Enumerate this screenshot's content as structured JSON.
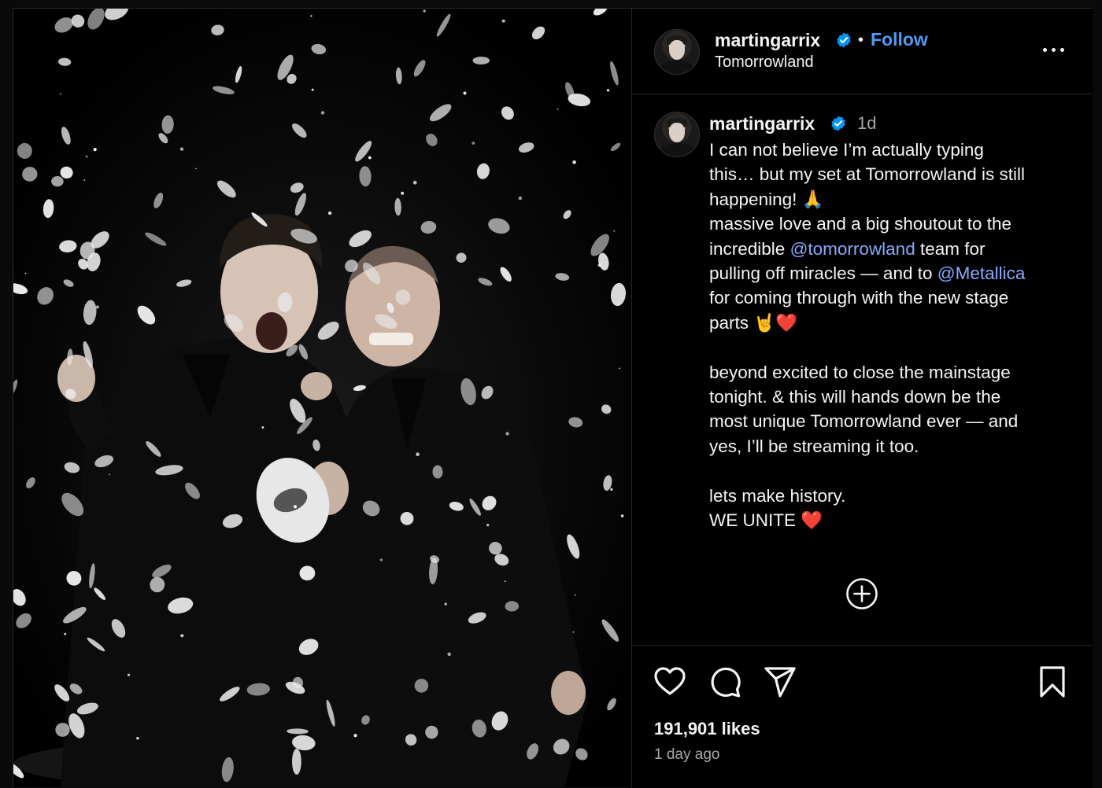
{
  "post": {
    "username": "martingarrix",
    "location": "Tomorrowland",
    "follow_label": "Follow",
    "separator": "•",
    "caption_time": "1d",
    "caption_lines": [
      {
        "parts": [
          {
            "t": "I can not believe I’m actually typing"
          }
        ]
      },
      {
        "parts": [
          {
            "t": "this… but my set at Tomorrowland is still"
          }
        ]
      },
      {
        "parts": [
          {
            "t": "happening! 🙏"
          }
        ]
      },
      {
        "parts": [
          {
            "t": "massive love and a big shoutout to the"
          }
        ]
      },
      {
        "parts": [
          {
            "t": "incredible "
          },
          {
            "t": "@tomorrowland",
            "mention": true
          },
          {
            "t": " team for"
          }
        ]
      },
      {
        "parts": [
          {
            "t": "pulling off miracles — and to "
          },
          {
            "t": "@Metallica",
            "mention": true
          }
        ]
      },
      {
        "parts": [
          {
            "t": "for coming through with the new stage"
          }
        ]
      },
      {
        "parts": [
          {
            "t": "parts 🤘❤️"
          }
        ]
      },
      {
        "parts": [
          {
            "t": ""
          }
        ]
      },
      {
        "parts": [
          {
            "t": "beyond excited to close the mainstage"
          }
        ]
      },
      {
        "parts": [
          {
            "t": "tonight. & this will hands down be the"
          }
        ]
      },
      {
        "parts": [
          {
            "t": "most unique Tomorrowland ever — and"
          }
        ]
      },
      {
        "parts": [
          {
            "t": "yes, I’ll be streaming it too."
          }
        ]
      },
      {
        "parts": [
          {
            "t": ""
          }
        ]
      },
      {
        "parts": [
          {
            "t": "lets make history."
          }
        ]
      },
      {
        "parts": [
          {
            "t": "WE UNITE ❤️"
          }
        ]
      }
    ],
    "likes": "191,901 likes",
    "posted": "1 day ago"
  },
  "icons": {
    "verified": "verified-badge-icon",
    "more": "more-options-icon",
    "load_more": "plus-circle-icon",
    "like": "heart-icon",
    "comment": "comment-icon",
    "share": "share-icon",
    "save": "bookmark-icon"
  },
  "colors": {
    "background": "#000000",
    "text": "#f5f5f5",
    "secondary_text": "#a8a8a8",
    "link": "#4d9bf5",
    "mention": "#8aa9ff",
    "verified": "#0095f6",
    "divider": "#262626"
  }
}
